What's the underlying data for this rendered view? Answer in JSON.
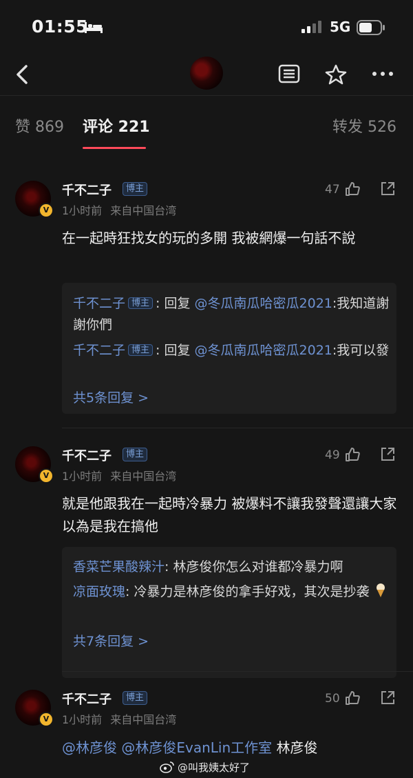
{
  "status": {
    "time": "01:55",
    "network": "5G"
  },
  "nav": {
    "title_icon": "avatar"
  },
  "tabs": [
    {
      "label": "赞 869"
    },
    {
      "label": "评论 221"
    },
    {
      "label": "转发 526"
    }
  ],
  "comments": [
    {
      "user": "千不二子",
      "badge": "博主",
      "time": "1小时前",
      "source": "来自中国台湾",
      "likes": "47",
      "text": "在一起時狂找女的玩的多開 我被網爆一句話不說",
      "replies": [
        {
          "user": "千不二子",
          "badge": "博主",
          "prefix": ": 回复 ",
          "mention": "@冬瓜南瓜哈密瓜2021",
          "content": ":我知道謝謝你們"
        },
        {
          "user": "千不二子",
          "badge": "博主",
          "prefix": ": 回复 ",
          "mention": "@冬瓜南瓜哈密瓜2021",
          "content": ":我可以發"
        }
      ],
      "more": "共5条回复 >"
    },
    {
      "user": "千不二子",
      "badge": "博主",
      "time": "1小时前",
      "source": "来自中国台湾",
      "likes": "49",
      "text": "就是他跟我在一起時冷暴力 被爆料不讓我發聲還讓大家以為是我在搞他",
      "replies": [
        {
          "user": "香菜芒果酸辣汁",
          "content": ": 林彦俊你怎么对谁都冷暴力啊"
        },
        {
          "user": "凉面玫瑰",
          "content": ": 冷暴力是林彦俊的拿手好戏，其次是抄袭"
        }
      ],
      "more": "共7条回复 >"
    },
    {
      "user": "千不二子",
      "badge": "博主",
      "time": "1小时前",
      "source": "来自中国台湾",
      "likes": "50",
      "mention1": "@林彦俊",
      "mention2": "@林彦俊EvanLin工作室",
      "tail": " 林彦俊"
    }
  ],
  "watermark": "@叫我姨太好了",
  "colors": {
    "accent": "#ff4a5a",
    "link": "#6e92d2",
    "vip": "#f2b52d"
  }
}
